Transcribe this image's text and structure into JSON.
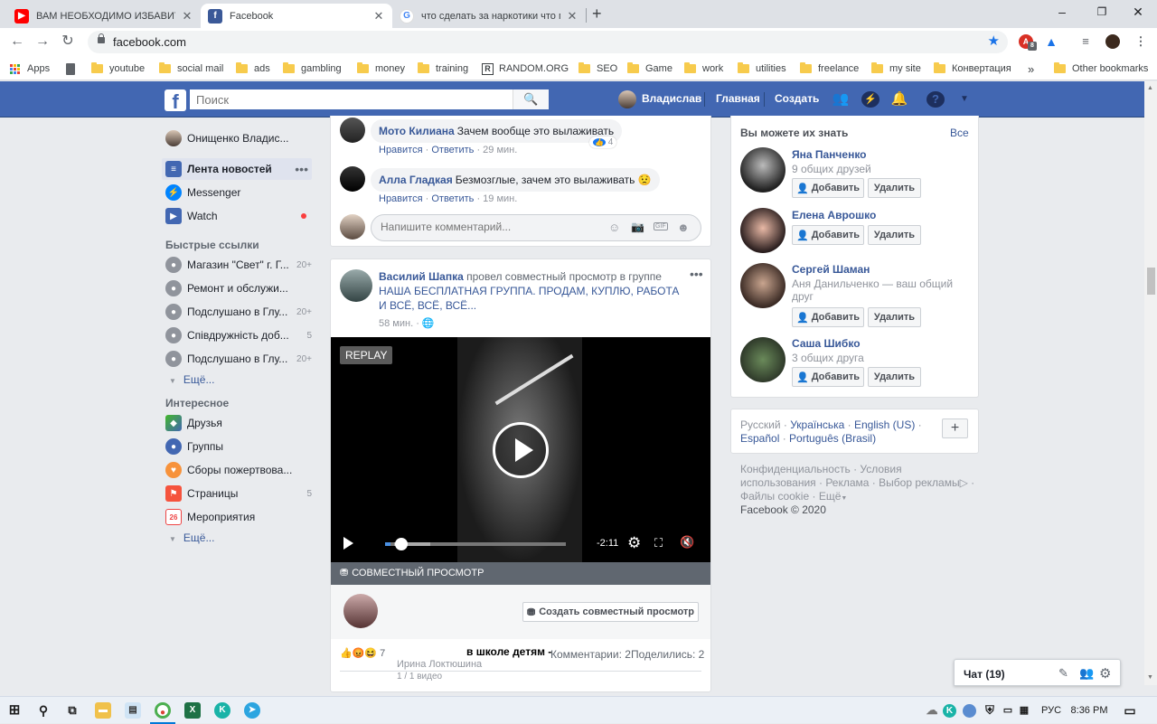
{
  "browser": {
    "tabs": [
      {
        "title": "ВАМ НЕОБХОДИМО ИЗБАВИТЬ",
        "active": false,
        "icon": "youtube-icon"
      },
      {
        "title": "Facebook",
        "active": true,
        "icon": "facebook-icon"
      },
      {
        "title": "что сделать за наркотики что пр",
        "active": false,
        "icon": "google-icon"
      }
    ],
    "new_tab": "+",
    "url": "facebook.com",
    "bookmarks": [
      "Apps",
      "youtube",
      "social mail",
      "ads",
      "gambling",
      "money",
      "training",
      "RANDOM.ORG",
      "SEO",
      "Game",
      "work",
      "utilities",
      "freelance",
      "my site",
      "Конвертация"
    ],
    "bookmarks_more": "»",
    "other_bookmarks": "Other bookmarks",
    "ext_badge": "8"
  },
  "fb_header": {
    "search_placeholder": "Поиск",
    "user_name": "Владислав",
    "home": "Главная",
    "create": "Создать"
  },
  "left_nav": {
    "profile": "Онищенко Владис...",
    "main": [
      {
        "label": "Лента новостей",
        "icon": "news-feed-icon"
      },
      {
        "label": "Messenger",
        "icon": "messenger-icon"
      },
      {
        "label": "Watch",
        "icon": "watch-icon"
      }
    ],
    "shortcuts_title": "Быстрые ссылки",
    "shortcuts": [
      {
        "label": "Магазин \"Свет\" г. Г...",
        "count": "20+"
      },
      {
        "label": "Ремонт и обслужи...",
        "count": ""
      },
      {
        "label": "Подслушано в Глу...",
        "count": "20+"
      },
      {
        "label": "Співдружність доб...",
        "count": "5"
      },
      {
        "label": "Подслушано в Глу...",
        "count": "20+"
      }
    ],
    "more1": "Ещё...",
    "explore_title": "Интересное",
    "explore": [
      {
        "label": "Друзья",
        "count": ""
      },
      {
        "label": "Группы",
        "count": ""
      },
      {
        "label": "Сборы пожертвова...",
        "count": ""
      },
      {
        "label": "Страницы",
        "count": "5"
      },
      {
        "label": "Мероприятия",
        "count": ""
      }
    ],
    "more2": "Ещё..."
  },
  "feed": {
    "comments": [
      {
        "name": "Мото Килиана",
        "text": "Зачем вообще это вылаживать",
        "like": "Нравится",
        "reply": "Ответить",
        "time": "29 мин.",
        "reactions": "4"
      },
      {
        "name": "Алла Гладкая",
        "text": "Безмозглые, зачем это вылаживать 😟",
        "like": "Нравится",
        "reply": "Ответить",
        "time": "19 мин."
      }
    ],
    "comment_placeholder": "Напишите комментарий...",
    "post": {
      "author": "Василий Шапка",
      "action": "провел совместный просмотр в группе",
      "group": "НАША БЕСПЛАТНАЯ ГРУППА. ПРОДАМ, КУПЛЮ, РАБОТА И ВСЁ, ВСЁ, ВСЁ...",
      "time": "58 мин.",
      "replay": "REPLAY",
      "video_time": "-2:11",
      "watch_party": "СОВМЕСТНЫЙ ПРОСМОТР",
      "create_watch_party": "Создать совместный просмотр",
      "reactions_count": "7",
      "overlay_title": "в школе детям -",
      "overlay_author": "Ирина Локтюшина",
      "overlay_count": "1 / 1 видео",
      "comments": "Комментарии: 2",
      "shares": "Поделились: 2",
      "progress": 0.03
    }
  },
  "pymk": {
    "title": "Вы можете их знать",
    "all": "Все",
    "add": "Добавить",
    "remove": "Удалить",
    "people": [
      {
        "name": "Яна Панченко",
        "sub": "9 общих друзей"
      },
      {
        "name": "Елена Аврошко",
        "sub": ""
      },
      {
        "name": "Сергей Шаман",
        "sub": "Аня Данильченко — ваш общий друг"
      },
      {
        "name": "Саша Шибко",
        "sub": "3 общих друга"
      }
    ]
  },
  "languages": {
    "current": "Русский",
    "others": [
      "Українська",
      "English (US)",
      "Español",
      "Português (Brasil)"
    ],
    "plus": "+"
  },
  "footer": {
    "links": [
      "Конфиденциальность",
      "Условия использования",
      "Реклама",
      "Выбор рекламы",
      "Файлы cookie",
      "Ещё"
    ],
    "copyright": "Facebook © 2020"
  },
  "chat": {
    "label": "Чат (19)"
  },
  "taskbar": {
    "lang": "РУС",
    "time": "8:36 PM"
  },
  "colors": {
    "fb_blue": "#4267b2",
    "link": "#385898"
  }
}
